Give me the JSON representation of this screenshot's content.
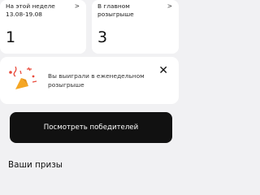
{
  "stats": [
    {
      "label_line1": "На этой неделе",
      "label_line2": "13.08-19.08",
      "value": "1",
      "chevron": ">"
    },
    {
      "label_line1": "В главном",
      "label_line2": "розыгрыше",
      "value": "3",
      "chevron": ">"
    }
  ],
  "promo": {
    "text_line1": "Вы выиграли в еженедельном",
    "text_line2": "розыгрыше",
    "close": "✕",
    "icon": "party-popper-icon"
  },
  "winners_button": {
    "label": "Посмотреть победителей"
  },
  "prizes_section": {
    "title": "Ваши призы"
  },
  "colors": {
    "accent_orange": "#f5a623",
    "confetti_red": "#e94b3c",
    "button_bg": "#111111"
  }
}
